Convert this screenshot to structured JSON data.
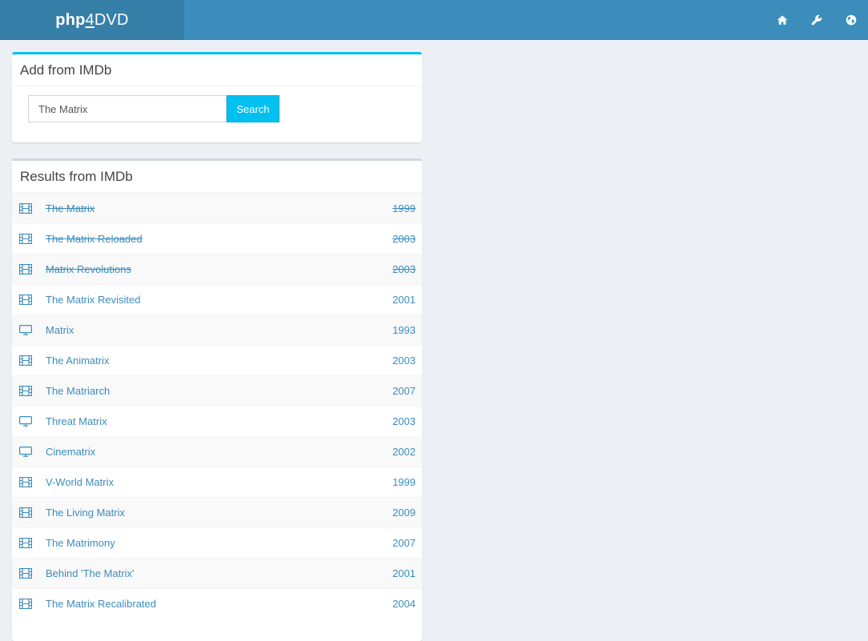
{
  "app": {
    "logo_prefix": "php",
    "logo_num": "4",
    "logo_suffix": "DVD"
  },
  "nav": {
    "icons": [
      {
        "name": "home-icon"
      },
      {
        "name": "wrench-icon"
      },
      {
        "name": "globe-icon"
      }
    ]
  },
  "add_box": {
    "title": "Add from IMDb",
    "search_value": "The Matrix",
    "button_label": "Search"
  },
  "results_box": {
    "title": "Results from IMDb",
    "rows": [
      {
        "type": "film",
        "title": "The Matrix",
        "year": "1999",
        "owned": true
      },
      {
        "type": "film",
        "title": "The Matrix Reloaded",
        "year": "2003",
        "owned": true
      },
      {
        "type": "film",
        "title": "Matrix Revolutions",
        "year": "2003",
        "owned": true
      },
      {
        "type": "film",
        "title": "The Matrix Revisited",
        "year": "2001",
        "owned": false
      },
      {
        "type": "tv",
        "title": "Matrix",
        "year": "1993",
        "owned": false
      },
      {
        "type": "film",
        "title": "The Animatrix",
        "year": "2003",
        "owned": false
      },
      {
        "type": "film",
        "title": "The Matriarch",
        "year": "2007",
        "owned": false
      },
      {
        "type": "tv",
        "title": "Threat Matrix",
        "year": "2003",
        "owned": false
      },
      {
        "type": "tv",
        "title": "Cinematrix",
        "year": "2002",
        "owned": false
      },
      {
        "type": "film",
        "title": "V-World Matrix",
        "year": "1999",
        "owned": false
      },
      {
        "type": "film",
        "title": "The Living Matrix",
        "year": "2009",
        "owned": false
      },
      {
        "type": "film",
        "title": "The Matrimony",
        "year": "2007",
        "owned": false
      },
      {
        "type": "film",
        "title": "Behind 'The Matrix'",
        "year": "2001",
        "owned": false
      },
      {
        "type": "film",
        "title": "The Matrix Recalibrated",
        "year": "2004",
        "owned": false
      }
    ]
  },
  "colors": {
    "brand": "#3c8dbc",
    "brand_dark": "#367fa9",
    "accent": "#00c0ef"
  }
}
